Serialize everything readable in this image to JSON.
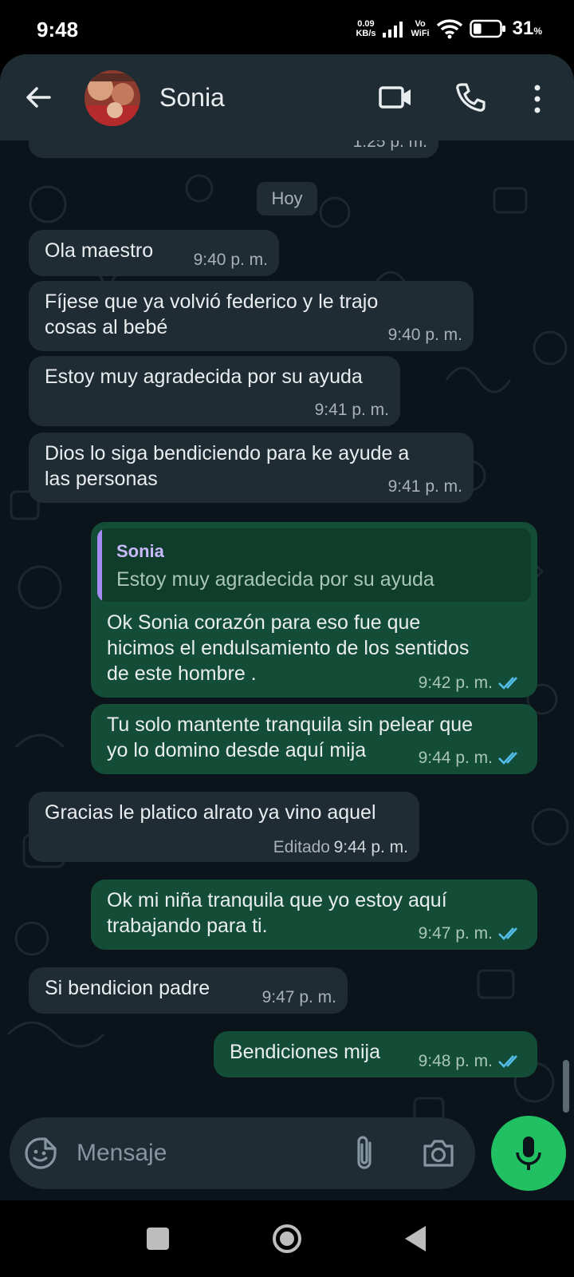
{
  "status_bar": {
    "time": "9:48",
    "net_speed_value": "0.09",
    "net_speed_unit": "KB/s",
    "vowifi_top": "Vo",
    "vowifi_bottom": "WiFi",
    "battery_percent": "31",
    "battery_unit": "%",
    "battery_level": 0.31
  },
  "header": {
    "contact_name": "Sonia"
  },
  "chat": {
    "partial_time": "1:25 p. m.",
    "day_label": "Hoy",
    "messages": [
      {
        "dir": "in",
        "lines": [
          "Ola maestro"
        ],
        "time": "9:40 p. m."
      },
      {
        "dir": "in",
        "lines": [
          "Fíjese que ya volvió federico y le trajo",
          "cosas al bebé"
        ],
        "time": "9:40 p. m."
      },
      {
        "dir": "in",
        "lines": [
          "Estoy muy agradecida por su ayuda"
        ],
        "time": "9:41 p. m."
      },
      {
        "dir": "in",
        "lines": [
          "Dios lo siga bendiciendo para ke ayude a",
          "las personas"
        ],
        "time": "9:41 p. m."
      },
      {
        "dir": "out",
        "quote_name": "Sonia",
        "quote_text": "Estoy muy agradecida por su ayuda",
        "lines": [
          "Ok  Sonia corazón para eso fue que",
          "hicimos el endulsamiento de los sentidos",
          "de este hombre ."
        ],
        "time": "9:42 p. m."
      },
      {
        "dir": "out",
        "lines": [
          "Tu solo mantente tranquila sin pelear que",
          "yo lo domino desde aquí mija"
        ],
        "time": "9:44 p. m."
      },
      {
        "dir": "in",
        "lines": [
          "Gracias le platico alrato ya vino aquel"
        ],
        "edited_label": "Editado",
        "time": "9:44 p. m."
      },
      {
        "dir": "out",
        "lines": [
          "Ok mi niña tranquila que yo estoy aquí",
          "trabajando para ti."
        ],
        "time": "9:47 p. m."
      },
      {
        "dir": "in",
        "lines": [
          "Si bendicion padre"
        ],
        "time": "9:47 p. m."
      },
      {
        "dir": "out",
        "lines": [
          "Bendiciones mija"
        ],
        "time": "9:48 p. m."
      }
    ]
  },
  "composer": {
    "placeholder": "Mensaje"
  },
  "icons": {
    "back": "arrow-left-icon",
    "video": "video-camera-icon",
    "call": "phone-icon",
    "menu": "more-vertical-icon",
    "emoji": "sticker-emoji-icon",
    "attach": "paperclip-icon",
    "camera": "camera-icon",
    "mic": "microphone-icon"
  },
  "colors": {
    "header_bg": "#1f2c33",
    "chat_bg": "#0b141a",
    "incoming_bubble": "#1f2c33",
    "outgoing_bubble": "#144d37",
    "accent_green": "#21c063",
    "read_ticks": "#53bdeb",
    "quote_accent": "#a38df3"
  }
}
